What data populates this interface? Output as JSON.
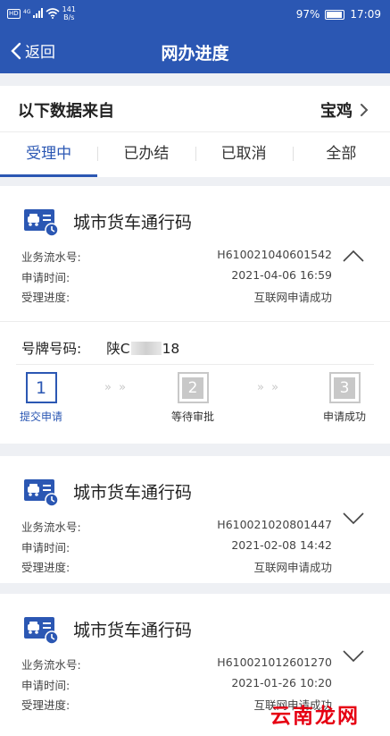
{
  "status_bar": {
    "network_badge": "HD",
    "signal": "4G",
    "speed": "141",
    "speed_unit": "B/s",
    "battery": "97%",
    "time": "17:09"
  },
  "nav": {
    "back_label": "返回",
    "title": "网办进度"
  },
  "source": {
    "label": "以下数据来自",
    "city": "宝鸡"
  },
  "tabs": [
    "受理中",
    "已办结",
    "已取消",
    "全部"
  ],
  "active_tab": "受理中",
  "labels": {
    "serial": "业务流水号:",
    "apply_time": "申请时间:",
    "progress": "受理进度:",
    "plate": "号牌号码:"
  },
  "cards": [
    {
      "title": "城市货车通行码",
      "serial": "H610021040601542",
      "apply_time": "2021-04-06 16:59",
      "progress": "互联网申请成功",
      "expanded": true,
      "plate_prefix": "陕C",
      "plate_suffix": "18",
      "steps": [
        {
          "num": "1",
          "label": "提交申请",
          "active": true
        },
        {
          "num": "2",
          "label": "等待审批",
          "active": false
        },
        {
          "num": "3",
          "label": "申请成功",
          "active": false
        }
      ]
    },
    {
      "title": "城市货车通行码",
      "serial": "H610021020801447",
      "apply_time": "2021-02-08 14:42",
      "progress": "互联网申请成功",
      "expanded": false
    },
    {
      "title": "城市货车通行码",
      "serial": "H610021012601270",
      "apply_time": "2021-01-26 10:20",
      "progress": "互联网申请成功",
      "expanded": false
    }
  ],
  "watermark": "云南龙网",
  "colors": {
    "primary": "#2b57b3",
    "watermark": "#e60012"
  },
  "icons": {
    "back": "chevron-left-icon",
    "city_arrow": "chevron-right-icon",
    "card": "truck-document-clock-icon",
    "expand": "chevron-down-icon",
    "collapse": "chevron-up-icon"
  }
}
